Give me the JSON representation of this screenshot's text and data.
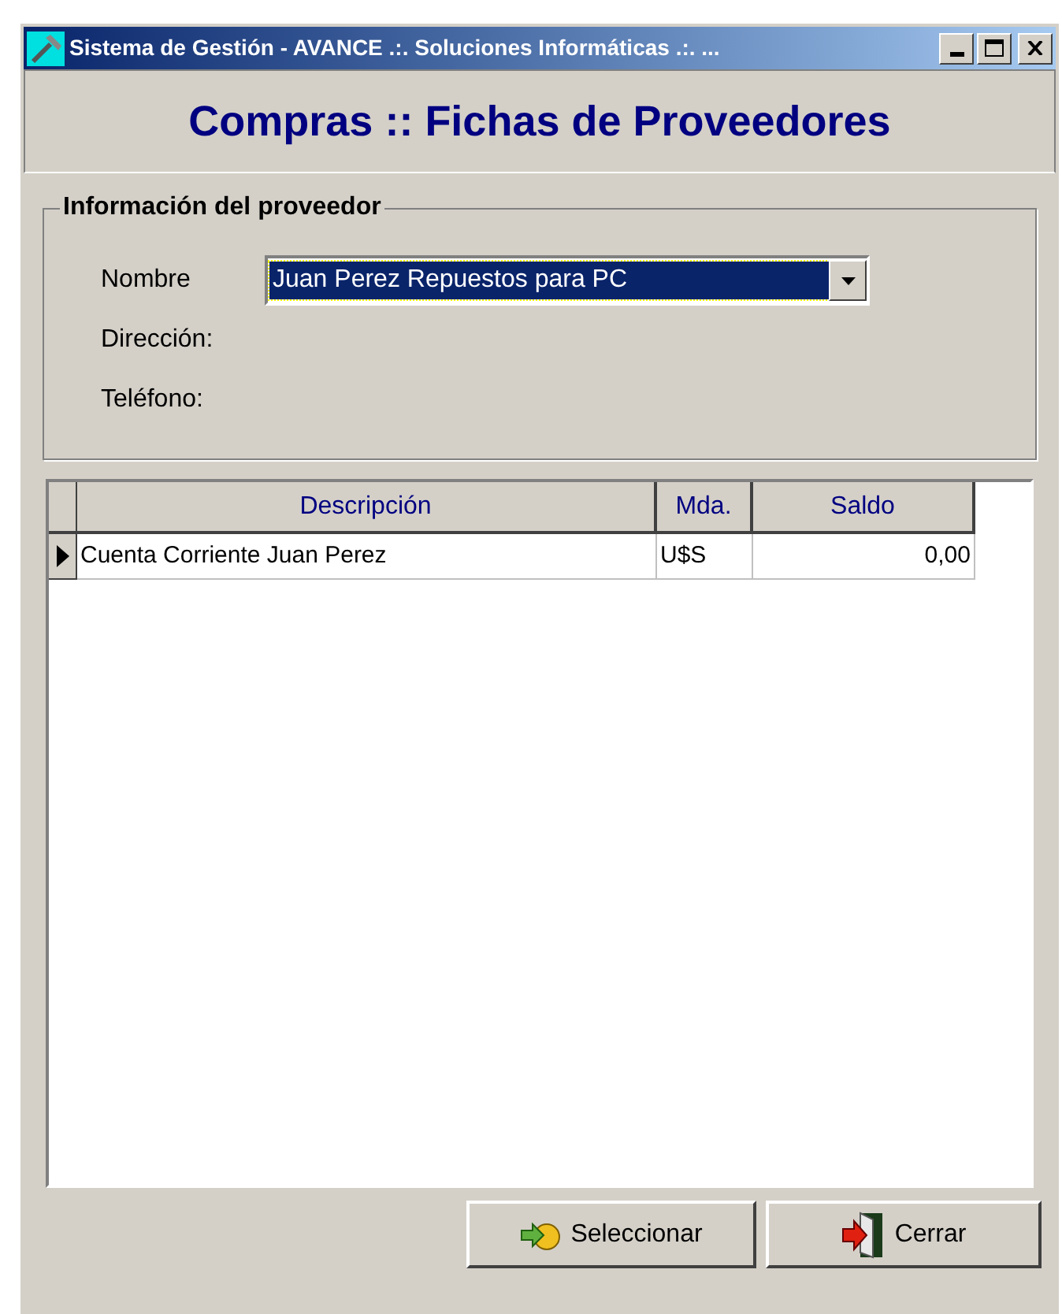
{
  "window": {
    "title": "Sistema de Gestión - AVANCE .:. Soluciones Informáticas .:. ..."
  },
  "header": {
    "title": "Compras :: Fichas de Proveedores"
  },
  "supplier_info": {
    "legend": "Información del proveedor",
    "fields": [
      {
        "kind": "combo",
        "label": "Nombre",
        "value": "Juan Perez Repuestos para PC"
      },
      {
        "kind": "text",
        "label": "Dirección:"
      },
      {
        "kind": "text",
        "label": "Teléfono:"
      }
    ]
  },
  "table": {
    "columns": [
      "Descripción",
      "Mda.",
      "Saldo"
    ],
    "rows": [
      {
        "selected": true,
        "cells": [
          "Cuenta Corriente Juan Perez",
          "U$S",
          "0,00"
        ]
      }
    ]
  },
  "buttons": [
    {
      "kind": "select",
      "label": "Seleccionar"
    },
    {
      "kind": "close",
      "label": "Cerrar"
    }
  ]
}
